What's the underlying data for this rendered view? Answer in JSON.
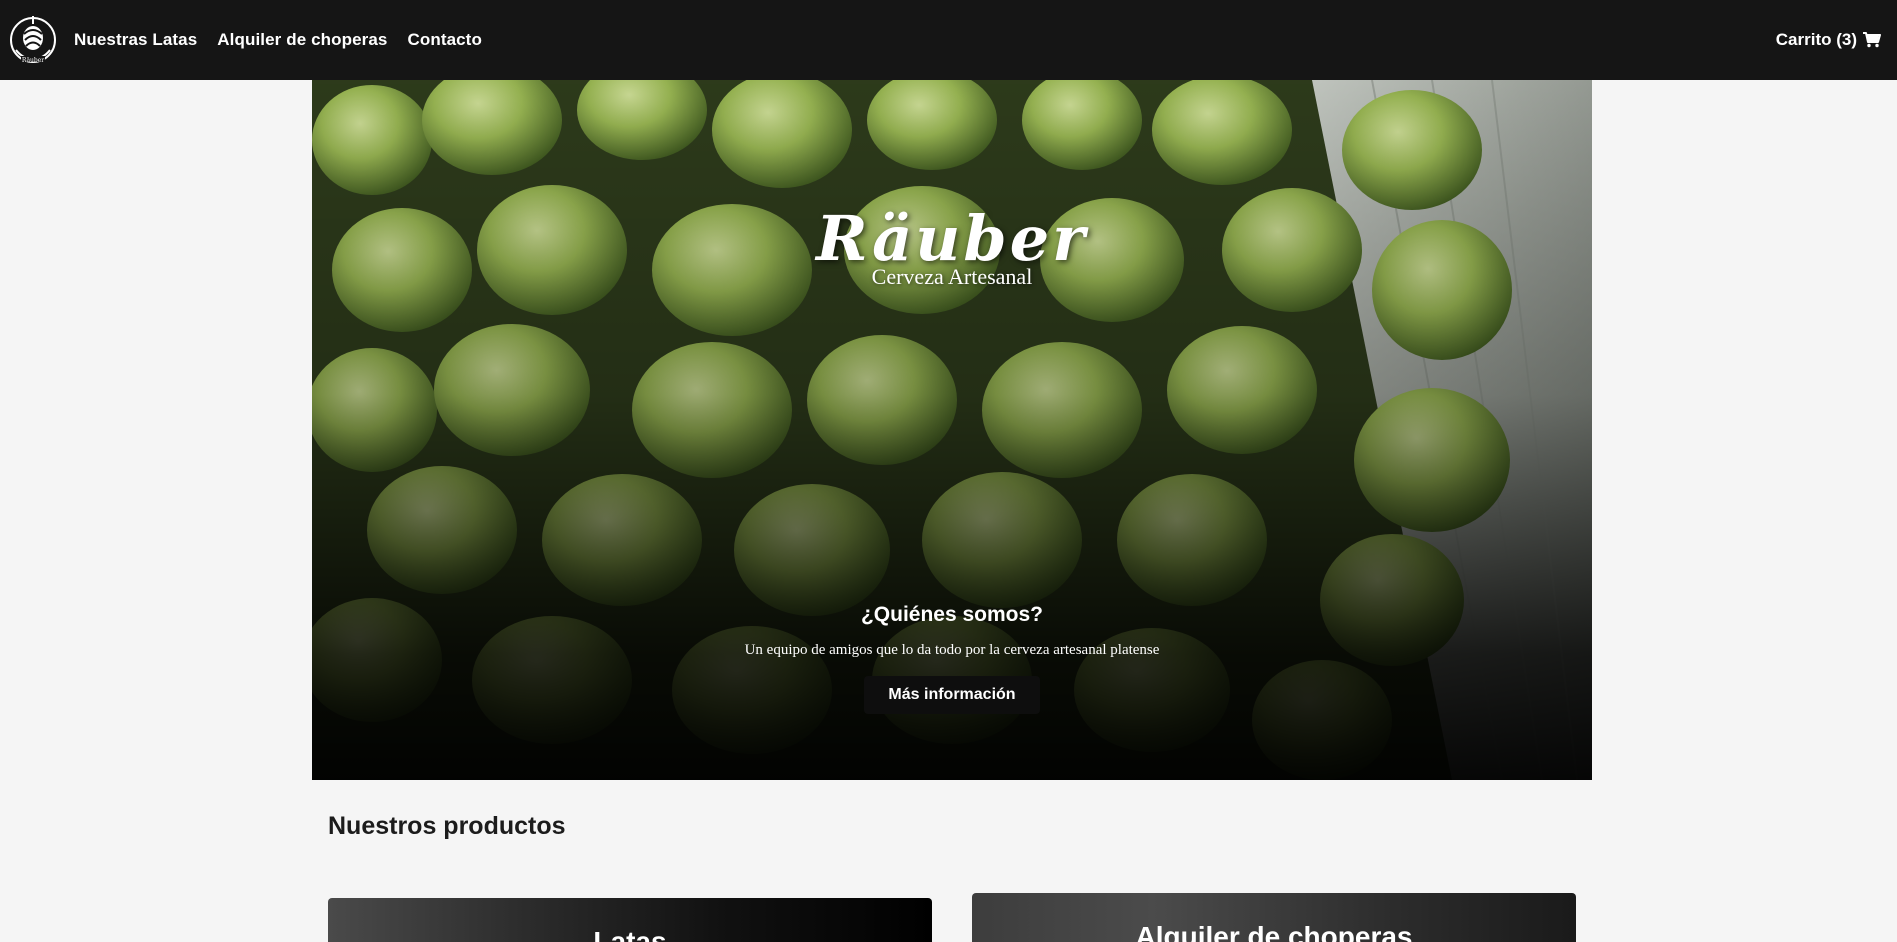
{
  "nav": {
    "links": [
      "Nuestras Latas",
      "Alquiler de choperas",
      "Contacto"
    ],
    "cart_label": "Carrito (3)"
  },
  "hero": {
    "brand_name": "Räuber",
    "brand_sub": "Cerveza Artesanal",
    "caption_title": "¿Quiénes somos?",
    "caption_text": "Un equipo de amigos que lo da todo por la cerveza artesanal platense",
    "button_label": "Más información"
  },
  "products": {
    "title": "Nuestros productos",
    "cards": [
      "Latas",
      "Alquiler de choperas"
    ]
  },
  "colors": {
    "navbar": "#151515",
    "page_bg": "#f5f5f5",
    "hop_green": "#8fb04a",
    "button_bg": "#0e0e0e"
  },
  "icons": [
    "logo-icon",
    "cart-icon"
  ]
}
